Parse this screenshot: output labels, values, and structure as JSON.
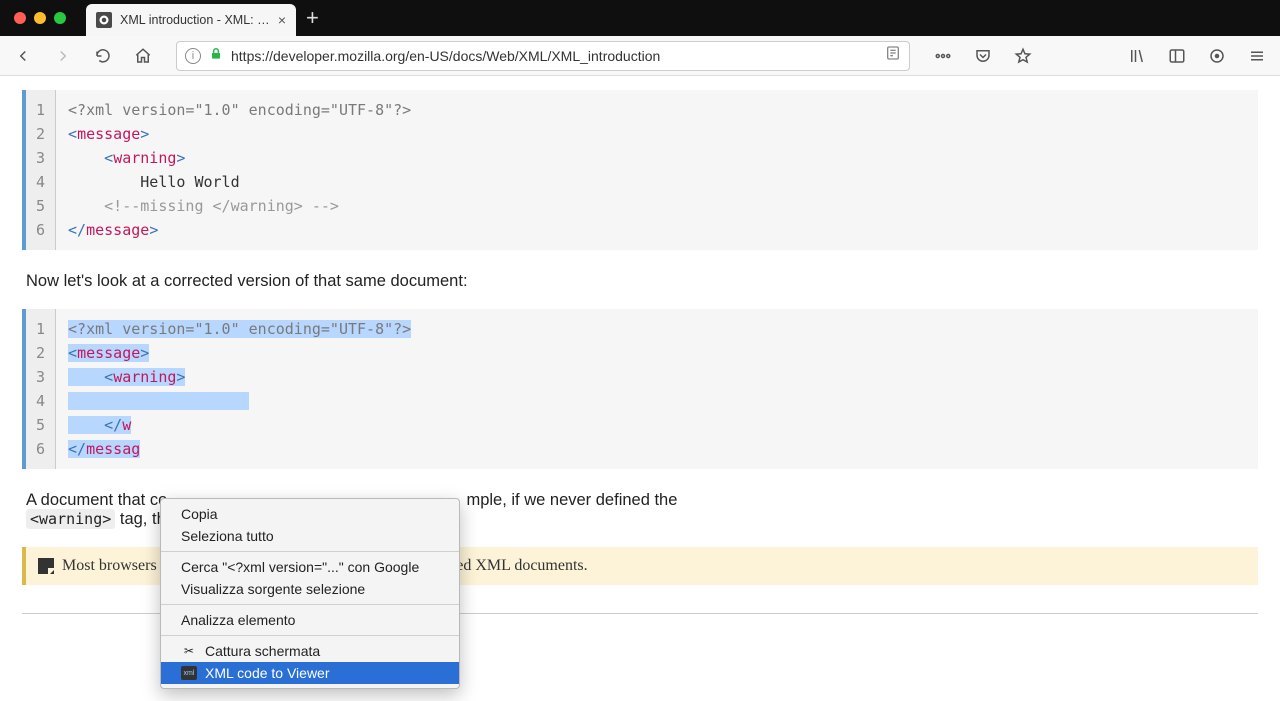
{
  "window": {
    "tab_title": "XML introduction - XML: Extens",
    "url": "https://developer.mozilla.org/en-US/docs/Web/XML/XML_introduction"
  },
  "code1": {
    "lines": [
      "1",
      "2",
      "3",
      "4",
      "5",
      "6"
    ],
    "l1_a": "<?xml version=\"1.0\" encoding=\"UTF-8\"?>",
    "l2_a": "<",
    "l2_b": "message",
    "l2_c": ">",
    "l3_a": "    <",
    "l3_b": "warning",
    "l3_c": ">",
    "l4_a": "        Hello World",
    "l5_a": "    <!--missing </warning> -->",
    "l6_a": "</",
    "l6_b": "message",
    "l6_c": ">"
  },
  "para1": "Now let's look at a corrected version of that same document:",
  "code2": {
    "lines": [
      "1",
      "2",
      "3",
      "4",
      "5",
      "6"
    ],
    "l1_a": "<?xml version=\"1.0\" encoding=\"UTF-8\"?>",
    "l2_a": "<",
    "l2_b": "message",
    "l2_c": ">",
    "l3_a": "    <",
    "l3_b": "warning",
    "l3_c": ">",
    "l4_a": "        ",
    "l5_a": "    </",
    "l5_b": "w",
    "l6_a": "</",
    "l6_b": "messag"
  },
  "para2_a": "A document that co",
  "para2_b": "mple, if we never defined the ",
  "para2_tag": "<warning>",
  "para2_c": " tag, th",
  "note": "Most browsers offer a debugger that can identify poorly-formed XML documents.",
  "ctx": {
    "copy": "Copia",
    "select_all": "Seleziona tutto",
    "search": "Cerca \"<?xml version=\"...\" con Google",
    "view_source": "Visualizza sorgente selezione",
    "inspect": "Analizza elemento",
    "screenshot": "Cattura schermata",
    "xml_viewer": "XML code to Viewer"
  }
}
